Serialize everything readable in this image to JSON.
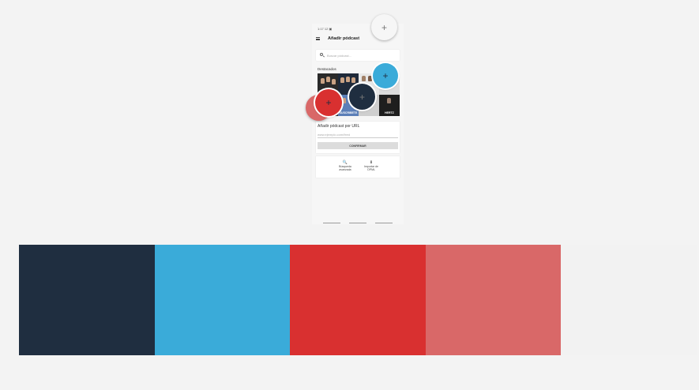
{
  "status_bar": {
    "time": "1:17 12 ▣"
  },
  "app_bar": {
    "title": "Añadir pódcast",
    "menu_icon": "hamburger-menu-icon"
  },
  "search": {
    "placeholder": "Buscar pódcast...",
    "icon": "search-icon"
  },
  "featured": {
    "label": "Destacados",
    "tiles": [
      {
        "bg": "#2a2a2a",
        "text": ""
      },
      {
        "bg": "#1f2a3a",
        "text": ""
      },
      {
        "bg": "#e8e8e8",
        "text": ""
      },
      {
        "bg": "#dcdcdc",
        "text": ""
      },
      {
        "bg": "#333333",
        "text": ""
      },
      {
        "bg": "#5c7fb8",
        "text": "SUSCRIBETE"
      },
      {
        "bg": "#cfcfcf",
        "text": ""
      },
      {
        "bg": "#1e1e1e",
        "text": "HERTZ"
      }
    ]
  },
  "url_section": {
    "title": "Añadir pódcast por URL",
    "placeholder": "www.ejemplo.com/feed",
    "confirm_label": "CONFIRMAR"
  },
  "tools": [
    {
      "icon": "search-icon",
      "glyph": "🔍",
      "label_line1": "Búsqueda",
      "label_line2": "avanzada"
    },
    {
      "icon": "download-icon",
      "glyph": "⬇",
      "label_line1": "Importar de",
      "label_line2": "OPML"
    }
  ],
  "fab_icon": "plus-icon",
  "fab_glyph": "+",
  "palette": [
    "#1f2e40",
    "#3aabd9",
    "#d93030",
    "#d96868",
    "#f2f2f2"
  ]
}
